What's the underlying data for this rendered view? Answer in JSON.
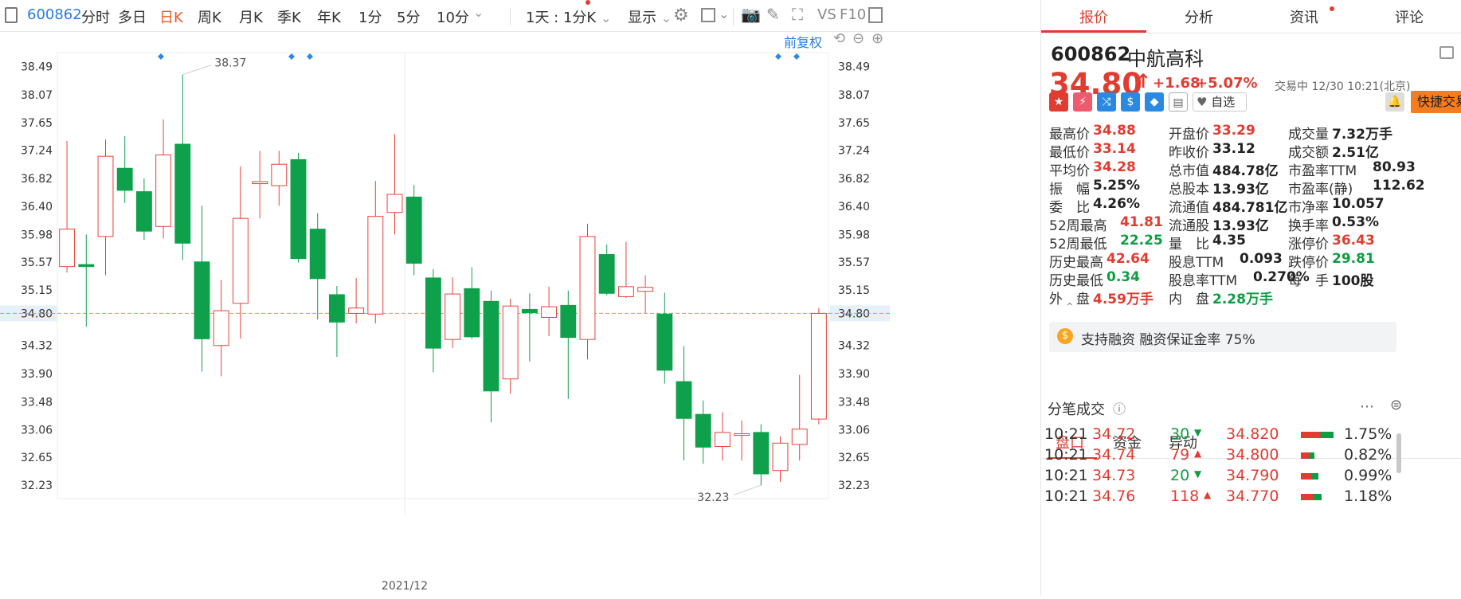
{
  "toolbar": {
    "code": "600862",
    "periods": [
      "分时",
      "多日",
      "日K",
      "周K",
      "月K",
      "季K",
      "年K",
      "1分",
      "5分",
      "10分"
    ],
    "active_period": "日K",
    "dropdown": "1天 : 1分K",
    "display": "显示",
    "vs": "VS",
    "f10": "F10",
    "fuquan": "前复权"
  },
  "chart_data": {
    "type": "candlestick",
    "y_ticks": [
      "38.49",
      "38.07",
      "37.65",
      "37.24",
      "36.82",
      "36.40",
      "35.98",
      "35.57",
      "35.15",
      "34.80",
      "34.32",
      "33.90",
      "33.48",
      "33.06",
      "32.65",
      "32.23"
    ],
    "ylim": [
      32.03,
      38.7
    ],
    "current_price": "34.80",
    "x_label": "2021/12",
    "max_label": "38.37",
    "min_label": "32.23",
    "candles": [
      {
        "o": 35.5,
        "c": 36.06,
        "h": 37.38,
        "l": 35.41
      },
      {
        "o": 35.53,
        "c": 35.5,
        "h": 35.98,
        "l": 34.6
      },
      {
        "o": 35.95,
        "c": 37.15,
        "h": 37.4,
        "l": 35.37
      },
      {
        "o": 36.97,
        "c": 36.64,
        "h": 37.45,
        "l": 36.45
      },
      {
        "o": 36.62,
        "c": 36.03,
        "h": 36.82,
        "l": 35.9
      },
      {
        "o": 36.1,
        "c": 37.17,
        "h": 37.7,
        "l": 35.92
      },
      {
        "o": 37.33,
        "c": 35.85,
        "h": 38.37,
        "l": 35.6
      },
      {
        "o": 35.57,
        "c": 34.42,
        "h": 36.41,
        "l": 33.93
      },
      {
        "o": 34.32,
        "c": 34.84,
        "h": 35.3,
        "l": 33.86
      },
      {
        "o": 34.95,
        "c": 36.22,
        "h": 37.0,
        "l": 34.42
      },
      {
        "o": 36.74,
        "c": 36.77,
        "h": 37.23,
        "l": 36.22
      },
      {
        "o": 36.71,
        "c": 37.03,
        "h": 37.23,
        "l": 36.41
      },
      {
        "o": 37.1,
        "c": 35.62,
        "h": 37.2,
        "l": 35.56
      },
      {
        "o": 36.06,
        "c": 35.32,
        "h": 36.3,
        "l": 34.71
      },
      {
        "o": 35.08,
        "c": 34.67,
        "h": 35.21,
        "l": 34.15
      },
      {
        "o": 34.8,
        "c": 34.88,
        "h": 35.33,
        "l": 34.65
      },
      {
        "o": 34.79,
        "c": 36.25,
        "h": 36.78,
        "l": 34.65
      },
      {
        "o": 36.31,
        "c": 36.58,
        "h": 37.48,
        "l": 35.98
      },
      {
        "o": 36.54,
        "c": 35.55,
        "h": 36.72,
        "l": 35.37
      },
      {
        "o": 35.33,
        "c": 34.28,
        "h": 35.46,
        "l": 33.92
      },
      {
        "o": 34.41,
        "c": 35.09,
        "h": 35.34,
        "l": 34.28
      },
      {
        "o": 35.17,
        "c": 34.45,
        "h": 35.49,
        "l": 34.42
      },
      {
        "o": 34.98,
        "c": 33.64,
        "h": 35.14,
        "l": 33.17
      },
      {
        "o": 33.82,
        "c": 34.91,
        "h": 35.02,
        "l": 33.6
      },
      {
        "o": 34.86,
        "c": 34.81,
        "h": 35.1,
        "l": 34.08
      },
      {
        "o": 34.74,
        "c": 34.9,
        "h": 35.2,
        "l": 34.46
      },
      {
        "o": 34.92,
        "c": 34.44,
        "h": 35.14,
        "l": 33.52
      },
      {
        "o": 34.41,
        "c": 35.95,
        "h": 36.14,
        "l": 34.11
      },
      {
        "o": 35.68,
        "c": 35.1,
        "h": 35.83,
        "l": 35.07
      },
      {
        "o": 35.05,
        "c": 35.2,
        "h": 35.87,
        "l": 35.03
      },
      {
        "o": 35.13,
        "c": 35.19,
        "h": 35.37,
        "l": 34.8
      },
      {
        "o": 34.79,
        "c": 33.95,
        "h": 35.11,
        "l": 33.75
      },
      {
        "o": 33.78,
        "c": 33.23,
        "h": 34.31,
        "l": 32.6
      },
      {
        "o": 33.29,
        "c": 32.8,
        "h": 33.5,
        "l": 32.55
      },
      {
        "o": 32.81,
        "c": 33.02,
        "h": 33.32,
        "l": 32.6
      },
      {
        "o": 32.98,
        "c": 33.0,
        "h": 33.2,
        "l": 32.6
      },
      {
        "o": 33.02,
        "c": 32.4,
        "h": 33.14,
        "l": 32.23
      },
      {
        "o": 32.45,
        "c": 32.86,
        "h": 32.96,
        "l": 32.28
      },
      {
        "o": 32.84,
        "c": 33.07,
        "h": 33.88,
        "l": 32.6
      },
      {
        "o": 33.22,
        "c": 34.8,
        "h": 34.88,
        "l": 33.14
      }
    ]
  },
  "panel": {
    "tabs": [
      "报价",
      "分析",
      "资讯",
      "评论"
    ],
    "code": "600862",
    "name": "中航高科",
    "price": "34.80",
    "arrow": "↑",
    "change": "+1.68",
    "pct": "+5.07%",
    "status": "交易中 12/30 10:21(北京)",
    "zixuan": "自选",
    "quick_trade": "快捷交易",
    "col1": [
      [
        "最高价",
        "34.88",
        "red"
      ],
      [
        "最低价",
        "33.14",
        "red"
      ],
      [
        "平均价",
        "34.28",
        "red"
      ],
      [
        "振　幅",
        "5.25%",
        "dark"
      ],
      [
        "委　比",
        "4.26%",
        "dark"
      ],
      [
        "52周最高",
        "41.81",
        "red"
      ],
      [
        "52周最低",
        "22.25",
        "green"
      ],
      [
        "历史最高",
        "42.64",
        "red"
      ],
      [
        "历史最低",
        "0.34",
        "green"
      ],
      [
        "外　盘",
        "4.59万手",
        "red"
      ]
    ],
    "col2": [
      [
        "开盘价",
        "33.29",
        "red"
      ],
      [
        "昨收价",
        "33.12",
        "dark"
      ],
      [
        "总市值",
        "484.78亿",
        "dark"
      ],
      [
        "总股本",
        "13.93亿",
        "dark"
      ],
      [
        "流通值",
        "484.781亿",
        "dark"
      ],
      [
        "流通股",
        "13.93亿",
        "dark"
      ],
      [
        "量　比",
        "4.35",
        "dark"
      ],
      [
        "股息TTM",
        "0.093",
        "dark"
      ],
      [
        "股息率TTM",
        "0.270%",
        "dark"
      ],
      [
        "内　盘",
        "2.28万手",
        "green"
      ]
    ],
    "col3": [
      [
        "成交量",
        "7.32万手",
        "dark"
      ],
      [
        "成交额",
        "2.51亿",
        "dark"
      ],
      [
        "市盈率TTM",
        "80.93",
        "dark"
      ],
      [
        "市盈率(静)",
        "112.62",
        "dark"
      ],
      [
        "市净率",
        "10.057",
        "dark"
      ],
      [
        "换手率",
        "0.53%",
        "dark"
      ],
      [
        "涨停价",
        "36.43",
        "red"
      ],
      [
        "跌停价",
        "29.81",
        "green"
      ],
      [
        "每　手",
        "100股",
        "dark"
      ],
      [
        "",
        ""
      ]
    ],
    "margin_note": "支持融资 融资保证金率 75%",
    "bottom_tabs": [
      "盘口",
      "资金",
      "异动"
    ],
    "ticks_title": "分笔成交",
    "ticks": [
      {
        "time": "10:21",
        "price": "34.72",
        "vol": "30",
        "dir": "down",
        "p2": "34.820",
        "pct": "1.75%",
        "bar": 0.85
      },
      {
        "time": "10:21",
        "price": "34.74",
        "vol": "79",
        "dir": "up",
        "p2": "34.800",
        "pct": "0.82%",
        "bar": 0.35
      },
      {
        "time": "10:21",
        "price": "34.73",
        "vol": "20",
        "dir": "down",
        "p2": "34.790",
        "pct": "0.99%",
        "bar": 0.45
      },
      {
        "time": "10:21",
        "price": "34.76",
        "vol": "118",
        "dir": "up",
        "p2": "34.770",
        "pct": "1.18%",
        "bar": 0.55
      }
    ]
  }
}
